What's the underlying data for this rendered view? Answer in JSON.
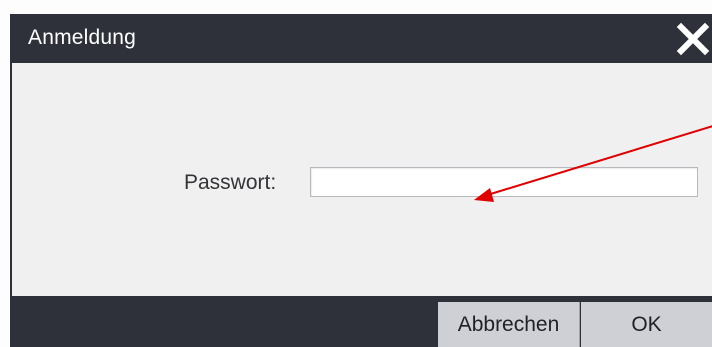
{
  "dialog": {
    "title": "Anmeldung",
    "close_icon": "close-x-icon"
  },
  "form": {
    "password_label": "Passwort:",
    "password_value": "",
    "password_placeholder": ""
  },
  "buttons": {
    "cancel_label": "Abbrechen",
    "ok_label": "OK"
  },
  "annotation": {
    "arrow_color": "#e00000"
  },
  "colors": {
    "titlebar": "#2e313a",
    "content_bg": "#f0f0f1",
    "button_bg": "#cfd0d5"
  }
}
